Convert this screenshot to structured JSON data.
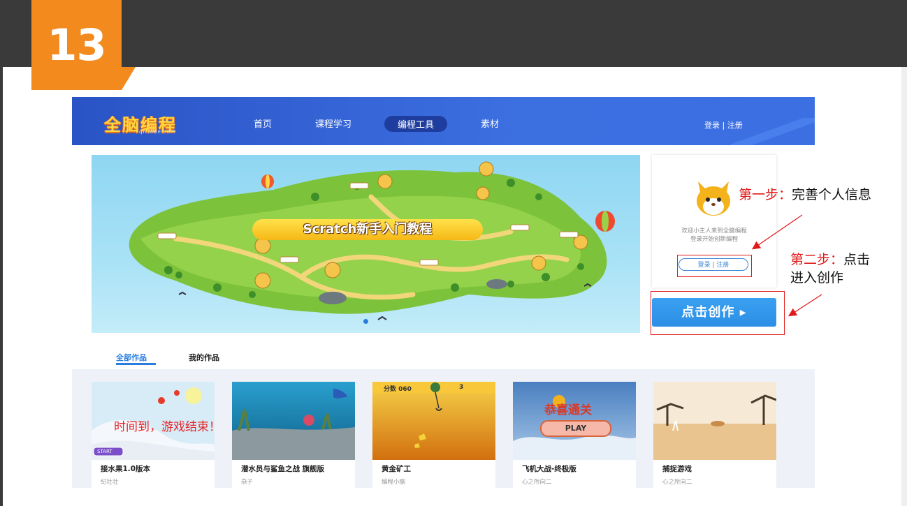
{
  "slide": {
    "number": "13"
  },
  "site": {
    "logo": {
      "text": "全脑编程",
      "subtext": "qncode.com"
    },
    "nav": {
      "items": [
        "首页",
        "课程学习",
        "编程工具",
        "素材"
      ],
      "active": "编程工具",
      "login": "登录 | 注册"
    },
    "banner": {
      "title": "Scratch新手入门教程"
    },
    "user_panel": {
      "welcome_line1": "欢迎小主人来到全脑编程",
      "welcome_line2": "登录开始创新编程",
      "login_button": "登录 | 注册"
    },
    "create_button": "点击创作 ▸",
    "tabs": [
      "全部作品",
      "我的作品"
    ],
    "works": [
      {
        "title": "接水果1.0版本",
        "author": "纪壮壮",
        "overlay": "时间到，游戏结束！",
        "badge": "START"
      },
      {
        "title": "潜水员与鲨鱼之战 旗舰版",
        "author": "燕子"
      },
      {
        "title": "黄金矿工",
        "author": "编程小脑",
        "hud_score_label": "分数",
        "hud_score": "060",
        "hud_level": "3"
      },
      {
        "title": "飞机大战-终极版",
        "author": "心之所向二",
        "overlay": "恭喜通关",
        "button": "PLAY"
      },
      {
        "title": "捕捉游戏",
        "author": "心之所向二"
      }
    ]
  },
  "annotations": {
    "step1_label": "第一步：",
    "step1_text": "完善个人信息",
    "step2_label": "第二步：",
    "step2_text_a": "点击",
    "step2_text_b": "进入创作",
    "color": "#e01a1a"
  }
}
